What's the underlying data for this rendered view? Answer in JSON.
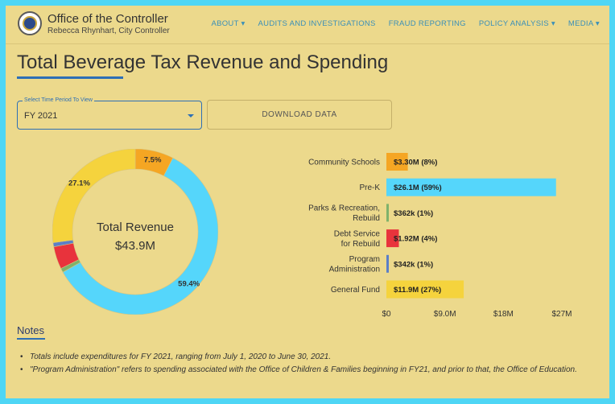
{
  "header": {
    "title": "Office of the Controller",
    "subtitle": "Rebecca Rhynhart, City Controller",
    "nav": [
      "ABOUT ▾",
      "AUDITS AND INVESTIGATIONS",
      "FRAUD REPORTING",
      "POLICY ANALYSIS ▾",
      "MEDIA ▾"
    ]
  },
  "page": {
    "title": "Total Beverage Tax Revenue and Spending"
  },
  "controls": {
    "select_label": "Select Time Period To View",
    "select_value": "FY 2021",
    "download_label": "DOWNLOAD DATA"
  },
  "colors": {
    "accent": "#2e6fb5",
    "background": "#ecd98c",
    "border": "#4fd6f5"
  },
  "chart_data": [
    {
      "type": "pie",
      "center_title": "Total Revenue",
      "center_value": "$43.9M",
      "slices": [
        {
          "label": "Community Schools",
          "value": 7.5,
          "display": "7.5%",
          "color": "#f5a623"
        },
        {
          "label": "Pre-K",
          "value": 59.4,
          "display": "59.4%",
          "color": "#55d6fb"
        },
        {
          "label": "Parks & Recreation, Rebuild",
          "value": 0.8,
          "display": "",
          "color": "#7fb26b"
        },
        {
          "label": "Debt Service for Rebuild",
          "value": 4.4,
          "display": "",
          "color": "#e8333c"
        },
        {
          "label": "Program Administration",
          "value": 0.8,
          "display": "",
          "color": "#5b7fc7"
        },
        {
          "label": "General Fund",
          "value": 27.1,
          "display": "27.1%",
          "color": "#f5d33d"
        }
      ]
    },
    {
      "type": "bar",
      "orientation": "horizontal",
      "categories": [
        "Community Schools",
        "Pre-K",
        "Parks & Recreation, Rebuild",
        "Debt Service for Rebuild",
        "Program Administration",
        "General Fund"
      ],
      "category_lines": [
        [
          "Community Schools"
        ],
        [
          "Pre-K"
        ],
        [
          "Parks & Recreation,",
          "Rebuild"
        ],
        [
          "Debt Service",
          "for Rebuild"
        ],
        [
          "Program",
          "Administration"
        ],
        [
          "General Fund"
        ]
      ],
      "values": [
        3.3,
        26.1,
        0.362,
        1.92,
        0.342,
        11.9
      ],
      "value_labels": [
        "$3.30M (8%)",
        "$26.1M (59%)",
        "$362k (1%)",
        "$1.92M (4%)",
        "$342k (1%)",
        "$11.9M (27%)"
      ],
      "colors": [
        "#f5a623",
        "#55d6fb",
        "#7fb26b",
        "#e8333c",
        "#5b7fc7",
        "#f5d33d"
      ],
      "xlim": [
        0,
        27
      ],
      "xticks": [
        0,
        9,
        18,
        27
      ],
      "xtick_labels": [
        "$0",
        "$9.0M",
        "$18M",
        "$27M"
      ],
      "units": "$M"
    }
  ],
  "notes": {
    "title": "Notes",
    "items": [
      "Totals include expenditures for FY 2021, ranging from July 1, 2020 to June 30, 2021.",
      "\"Program Administration\" refers to spending associated with the Office of Children & Families beginning in FY21, and prior to that, the Office of Education."
    ]
  }
}
